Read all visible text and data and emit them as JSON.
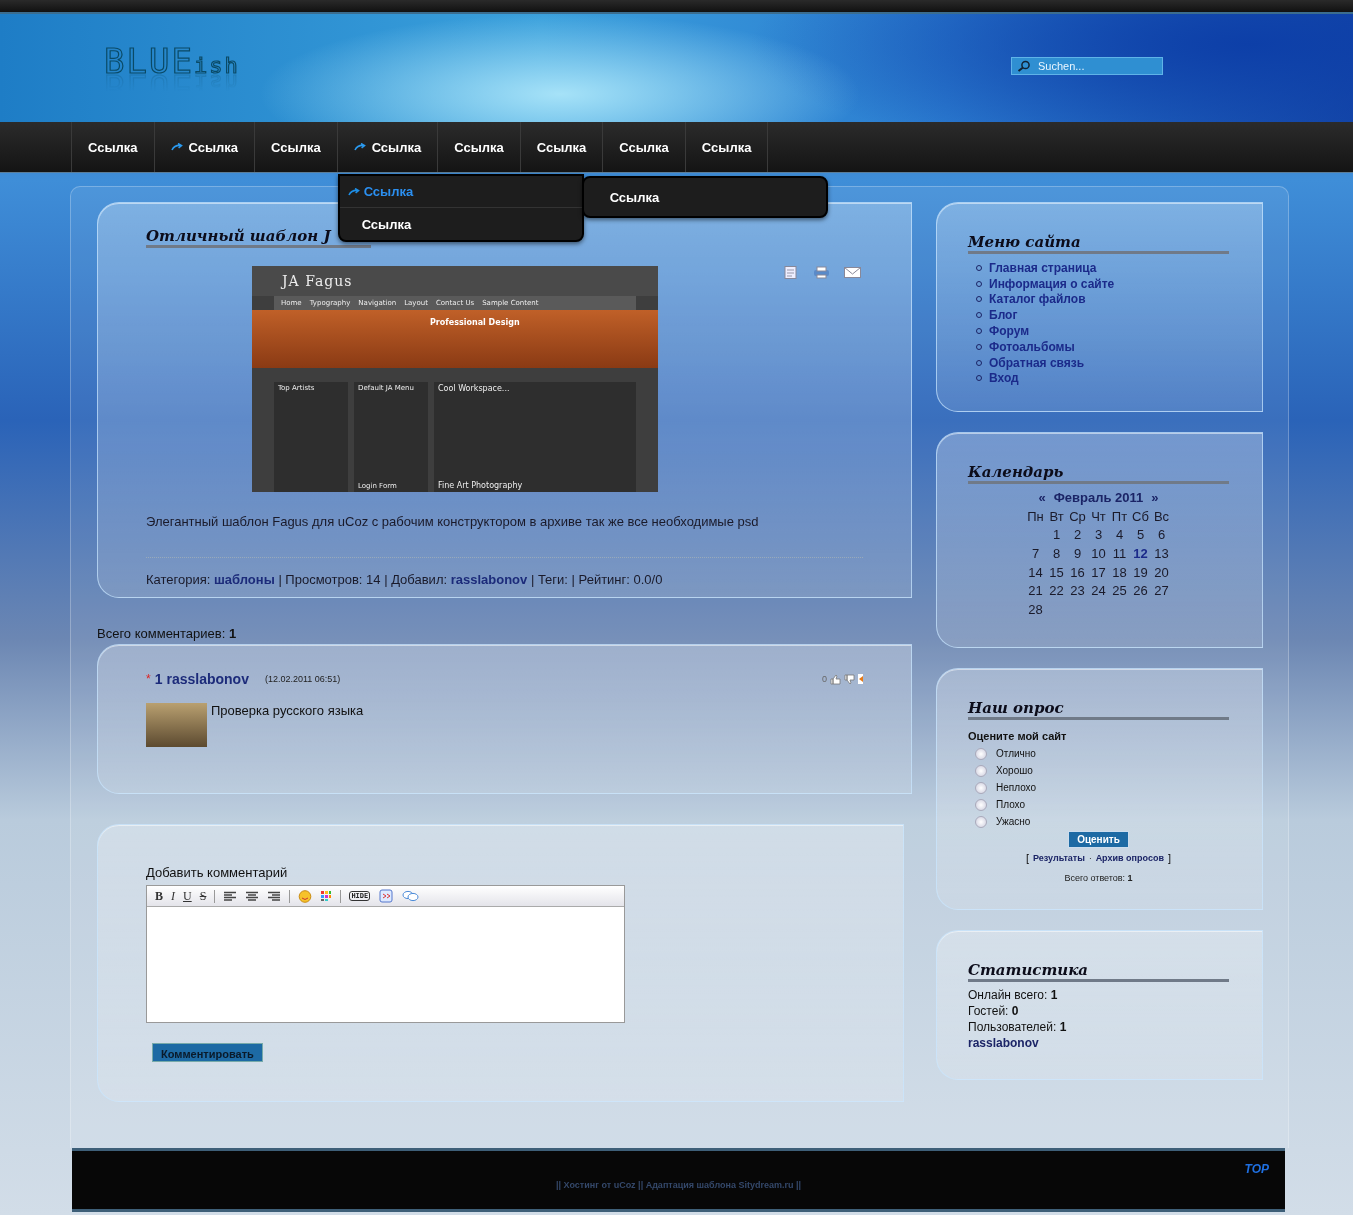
{
  "header": {
    "logo": {
      "main": "BLUE",
      "tail": "ish"
    },
    "search": {
      "placeholder": "Suchen..."
    }
  },
  "nav": {
    "items": [
      {
        "label": "Ссылка",
        "has_submenu": false
      },
      {
        "label": "Ссылка",
        "has_submenu": true
      },
      {
        "label": "Ссылка",
        "has_submenu": false
      },
      {
        "label": "Ссылка",
        "has_submenu": true,
        "children": [
          {
            "label": "Ссылка",
            "has_submenu": true,
            "expanded": true,
            "children": [
              {
                "label": "Ссылка",
                "has_submenu": false,
                "expanded": false
              }
            ]
          },
          {
            "label": "Ссылка",
            "has_submenu": false,
            "expanded": false
          }
        ]
      },
      {
        "label": "Ссылка",
        "has_submenu": false
      },
      {
        "label": "Ссылка",
        "has_submenu": false
      },
      {
        "label": "Ссылка",
        "has_submenu": false
      },
      {
        "label": "Ссылка",
        "has_submenu": false
      }
    ]
  },
  "post": {
    "title": "Отличный шаблон J",
    "preview": {
      "logo": "JA Fagus",
      "tabs": [
        "Home",
        "Typography",
        "Navigation",
        "Layout",
        "Contact Us",
        "Sample Content"
      ],
      "banner_title": "Professional Design",
      "side_headings": [
        "Top Artists",
        "Default JA Menu",
        "Login Form"
      ],
      "articles": [
        "Cool Workspace...",
        "Fine Art Photography"
      ]
    },
    "description": "Элегантный шаблон Fagus для uCoz с рабочим конструктором в архиве так же все необходимые psd",
    "meta": [
      {
        "kind": "text",
        "text": "Категория:"
      },
      {
        "kind": "link",
        "text": "шаблоны"
      },
      {
        "kind": "text",
        "text": "| Просмотров: 14 | Добавил:"
      },
      {
        "kind": "link",
        "text": "rasslabonov"
      },
      {
        "kind": "text",
        "text": "| Теги: | Рейтинг: 0.0/0"
      }
    ]
  },
  "comments": {
    "total": "Всего комментариев: **1**",
    "items": [
      {
        "marker": "*",
        "number": "1",
        "author": "rasslabonov",
        "date": "(12.02.2011 06:51)",
        "rating": "0",
        "text": "Проверка русского языка"
      }
    ]
  },
  "comment_form": {
    "title": "Добавить комментарий",
    "toolbar": [
      {
        "kind": "bold",
        "label": "B"
      },
      {
        "kind": "italic",
        "label": "I"
      },
      {
        "kind": "underline",
        "label": "U"
      },
      {
        "kind": "strike",
        "label": "S"
      },
      {
        "kind": "separator"
      },
      {
        "kind": "align-left"
      },
      {
        "kind": "align-center"
      },
      {
        "kind": "align-right"
      },
      {
        "kind": "separator"
      },
      {
        "kind": "smiley"
      },
      {
        "kind": "palette"
      },
      {
        "kind": "separator"
      },
      {
        "kind": "tag",
        "label": "HIDE"
      },
      {
        "kind": "quote"
      },
      {
        "kind": "chat"
      }
    ],
    "submit": "Комментировать"
  },
  "sidebar": [
    {
      "kind": "menu",
      "title": "Меню сайта",
      "items": [
        "Главная страница",
        "Информация о сайте",
        "Каталог файлов",
        "Блог",
        "Форум",
        "Фотоальбомы",
        "Обратная связь",
        "Вход"
      ]
    },
    {
      "kind": "calendar",
      "title": "Календарь",
      "prev": "«",
      "month": "Февраль 2011",
      "next": "»",
      "weekdays": [
        "Пн",
        "Вт",
        "Ср",
        "Чт",
        "Пт",
        "Сб",
        "Вс"
      ],
      "weeks": [
        [
          {
            "label": "1",
            "today": false
          },
          {
            "label": "2",
            "today": false
          },
          {
            "label": "3",
            "today": false
          },
          {
            "label": "4",
            "today": false
          },
          {
            "label": "5",
            "today": false
          },
          {
            "label": "6",
            "today": false
          }
        ],
        [
          {
            "label": "7",
            "today": false
          },
          {
            "label": "8",
            "today": false
          },
          {
            "label": "9",
            "today": false
          },
          {
            "label": "10",
            "today": false
          },
          {
            "label": "11",
            "today": false
          },
          {
            "label": "12",
            "today": true
          },
          {
            "label": "13",
            "today": false
          }
        ],
        [
          {
            "label": "14",
            "today": false
          },
          {
            "label": "15",
            "today": false
          },
          {
            "label": "16",
            "today": false
          },
          {
            "label": "17",
            "today": false
          },
          {
            "label": "18",
            "today": false
          },
          {
            "label": "19",
            "today": false
          },
          {
            "label": "20",
            "today": false
          }
        ],
        [
          {
            "label": "21",
            "today": false
          },
          {
            "label": "22",
            "today": false
          },
          {
            "label": "23",
            "today": false
          },
          {
            "label": "24",
            "today": false
          },
          {
            "label": "25",
            "today": false
          },
          {
            "label": "26",
            "today": false
          },
          {
            "label": "27",
            "today": false
          }
        ],
        [
          {
            "label": "28",
            "today": false
          }
        ]
      ]
    },
    {
      "kind": "poll",
      "title": "Наш опрос",
      "question": "Оцените мой сайт",
      "options": [
        {
          "label": "Отлично",
          "selected": false
        },
        {
          "label": "Хорошо",
          "selected": false
        },
        {
          "label": "Неплохо",
          "selected": false
        },
        {
          "label": "Плохо",
          "selected": false
        },
        {
          "label": "Ужасно",
          "selected": false
        }
      ],
      "button": "Оценить",
      "bracket_open": "[",
      "links": [
        "Результаты",
        "Архив опросов"
      ],
      "separator": "·",
      "bracket_close": "]",
      "total": "Всего ответов: **1**"
    },
    {
      "kind": "stats",
      "title": "Статистика",
      "lines": [
        "Онлайн всего: **1**",
        "Гостей: **0**",
        "Пользователей: **1**"
      ],
      "users": [
        "rasslabonov"
      ]
    }
  ],
  "footer": {
    "credits": "|| Хостинг от uCoz || Адаптация шаблона Sitydream.ru ||",
    "top": "TOP"
  }
}
